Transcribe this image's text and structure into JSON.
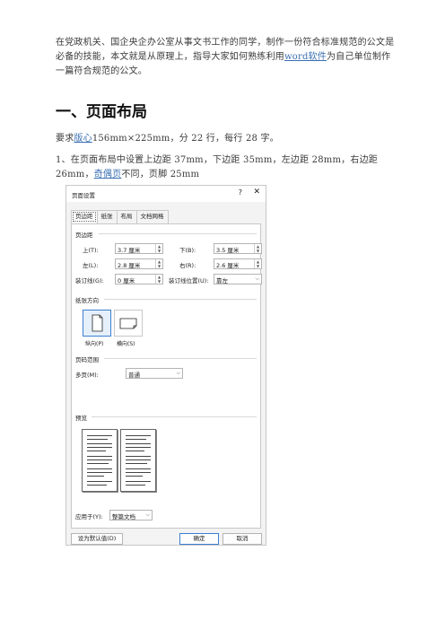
{
  "article": {
    "intro": {
      "part1": "在党政机关、国企央企办公室从事文书工作的同学，制作一份符合标准规范的公文是必备的技能，本文就是从原理上，指导大家如何熟练利用",
      "link": "word软件",
      "part2": "为自己单位制作一篇符合规范的公文。"
    },
    "heading": "一、页面布局",
    "req": {
      "part1": "要求",
      "link": "版心",
      "part2": "156mm×225mm，分 22 行，每行 28 字。"
    },
    "step1": {
      "part1": "1、在页面布局中设置上边距 37mm，下边距 35mm，左边距 28mm，右边距 26mm，",
      "link": "奇偶页",
      "part2": "不同，页脚 25mm"
    }
  },
  "dialog": {
    "title": "页面设置",
    "help": "?",
    "close": "✕",
    "tabs": [
      "页边距",
      "纸张",
      "布局",
      "文档网格"
    ],
    "margins_section": "页边距",
    "top_label": "上(T):",
    "top_value": "3.7 厘米",
    "bottom_label": "下(B):",
    "bottom_value": "3.5 厘米",
    "left_label": "左(L):",
    "left_value": "2.8 厘米",
    "right_label": "右(R):",
    "right_value": "2.6 厘米",
    "gutter_label": "装订线(G):",
    "gutter_value": "0 厘米",
    "gutter_pos_label": "装订线位置(U):",
    "gutter_pos_value": "靠左",
    "orientation_section": "纸张方向",
    "portrait": "纵向(P)",
    "landscape": "横向(S)",
    "pages_section": "页码范围",
    "multi_label": "多页(M):",
    "multi_value": "普通",
    "preview_section": "预览",
    "apply_label": "应用于(Y):",
    "apply_value": "整篇文档",
    "default_button": "设为默认值(D)",
    "ok_button": "确定",
    "cancel_button": "取消"
  }
}
